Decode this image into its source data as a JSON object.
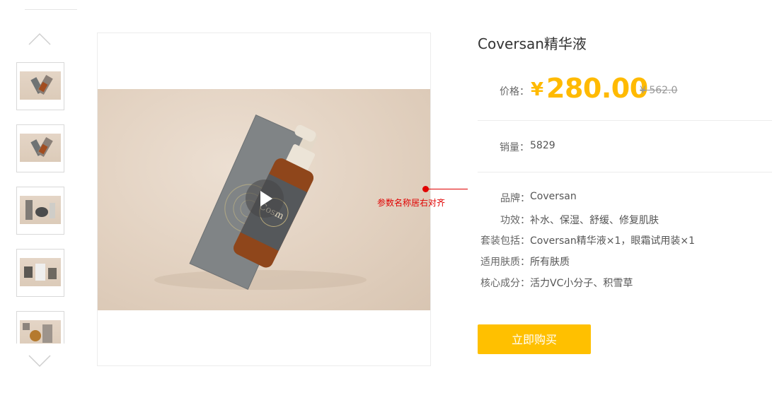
{
  "gallery": {
    "thumbnails": [
      "thumb-1",
      "thumb-2",
      "thumb-3",
      "thumb-4",
      "thumb-5"
    ],
    "up_icon": "chevron-up-icon",
    "down_icon": "chevron-down-icon"
  },
  "main_image": {
    "play_icon": "play-icon"
  },
  "annotation": {
    "text": "参数名称居右对齐",
    "color": "#e00000"
  },
  "product": {
    "title": "Coversan精华液",
    "price_label": "价格：",
    "price_symbol": "¥",
    "price": "280.00",
    "original_price": "¥ 562.0",
    "sales_label": "销量：",
    "sales": "5829",
    "params": [
      {
        "name": "品牌：",
        "value": "Coversan"
      },
      {
        "name": "功效：",
        "value": "补水、保湿、舒缓、修复肌肤"
      },
      {
        "name": "套装包括：",
        "value": "Coversan精华液×1，眼霜试用装×1"
      },
      {
        "name": "适用肤质：",
        "value": "所有肤质"
      },
      {
        "name": "核心成分：",
        "value": "活力VC小分子、积雪草"
      }
    ],
    "buy_label": "立即购买"
  },
  "colors": {
    "accent": "#ffba00",
    "buy_button": "#ffc000",
    "annotation": "#e00000"
  }
}
